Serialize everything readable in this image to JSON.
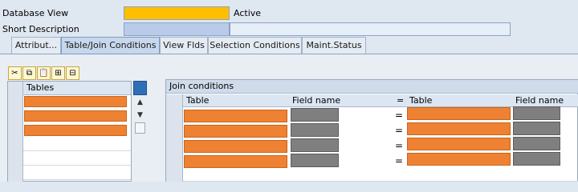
{
  "header": {
    "database_view_label": "Database View",
    "status_text": "Active",
    "short_description_label": "Short Description"
  },
  "tabs": [
    {
      "label": "Attribut..."
    },
    {
      "label": "Table/Join Conditions"
    },
    {
      "label": "View Flds"
    },
    {
      "label": "Selection Conditions"
    },
    {
      "label": "Maint.Status"
    }
  ],
  "active_tab": "Table/Join Conditions",
  "toolbar": {
    "icons": [
      "cut-icon",
      "copy-icon",
      "paste-icon",
      "insert-row-icon",
      "delete-row-icon"
    ]
  },
  "tables_grid": {
    "header": "Tables",
    "rows": 6
  },
  "join_grid": {
    "title": "Join conditions",
    "columns": [
      "Table",
      "Field name",
      "=",
      "Table",
      "Field name"
    ],
    "rows": 4,
    "eq_symbol": "="
  },
  "colors": {
    "highlight_yellow": "#ffbf00",
    "masked_orange": "#ee8232",
    "masked_gray": "#7f7f7f",
    "input_blue": "#b9cbe8"
  }
}
